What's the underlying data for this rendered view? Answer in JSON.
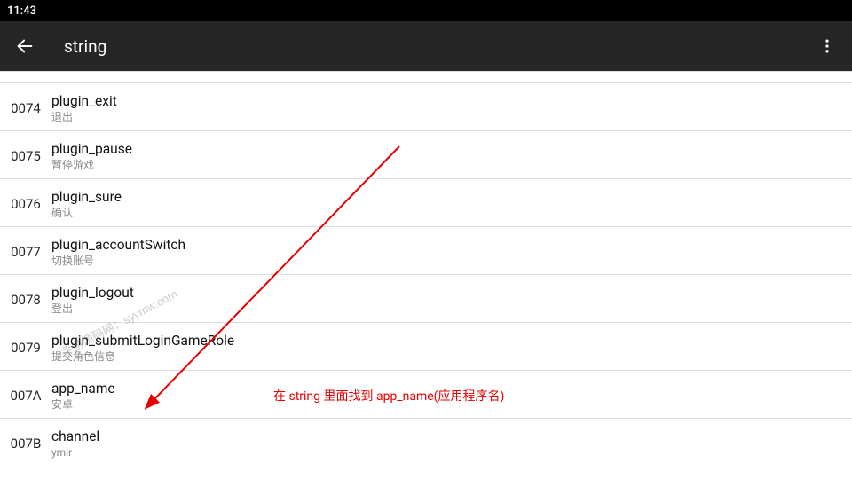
{
  "statusbar": {
    "time": "11:43"
  },
  "appbar": {
    "title": "string"
  },
  "rows": [
    {
      "idx": "0074",
      "key": "plugin_exit",
      "val": "退出"
    },
    {
      "idx": "0075",
      "key": "plugin_pause",
      "val": "暂停游戏"
    },
    {
      "idx": "0076",
      "key": "plugin_sure",
      "val": "确认"
    },
    {
      "idx": "0077",
      "key": "plugin_accountSwitch",
      "val": "切换账号"
    },
    {
      "idx": "0078",
      "key": "plugin_logout",
      "val": "登出"
    },
    {
      "idx": "0079",
      "key": "plugin_submitLoginGameRole",
      "val": "提交角色信息"
    },
    {
      "idx": "007A",
      "key": "app_name",
      "val": "安卓"
    },
    {
      "idx": "007B",
      "key": "channel",
      "val": "ymir"
    }
  ],
  "annotation": {
    "text": "在 string 里面找到 app_name(应用程序名)"
  },
  "watermark": {
    "text": "手游源码网：syymw.com"
  }
}
